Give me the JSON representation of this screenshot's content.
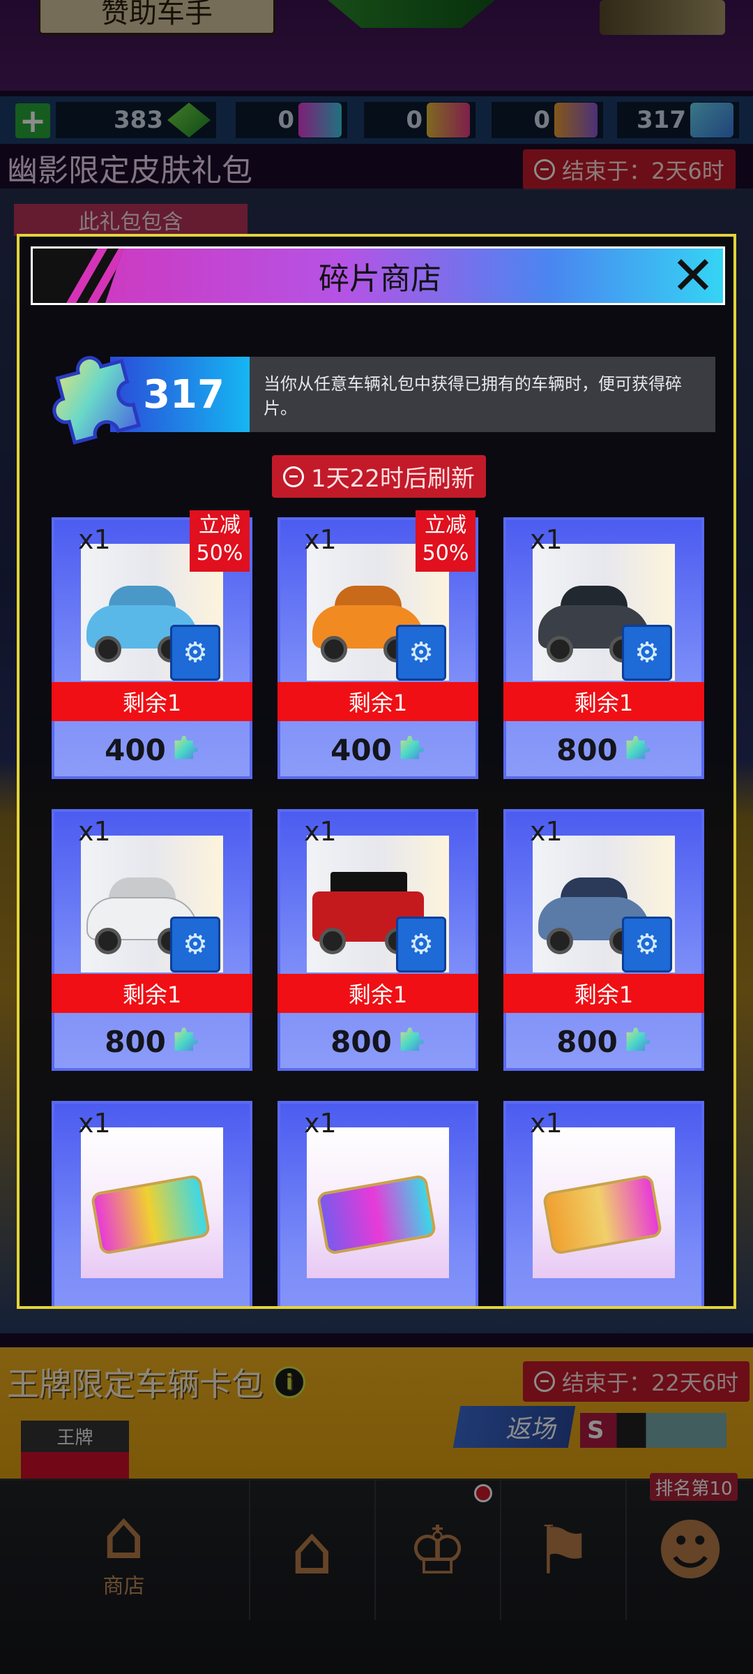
{
  "background": {
    "sponsor_label": "赞助车手",
    "resources": [
      {
        "value": "383",
        "icon": "green-gem-icon"
      },
      {
        "value": "0",
        "icon": "pink-skin-card-icon"
      },
      {
        "value": "0",
        "icon": "gold-skin-card-icon"
      },
      {
        "value": "0",
        "icon": "turbo-card-icon"
      },
      {
        "value": "317",
        "icon": "puzzle-icon"
      }
    ],
    "limited_pack_title": "幽影限定皮肤礼包",
    "limited_pack_timer": "结束于：2天6时",
    "pack_includes": "此礼包包含",
    "ace_pack_title": "王牌限定车辆卡包",
    "ace_pack_timer": "结束于：22天6时",
    "ace_tag": "王牌",
    "return_label": "返场",
    "s_badge": "S"
  },
  "modal": {
    "title": "碎片商店",
    "fragment_count": "317",
    "description": "当你从任意车辆礼包中获得已拥有的车辆时，便可获得碎片。",
    "refresh_text": "1天22时后刷新"
  },
  "items": [
    {
      "qty": "x1",
      "discount": "立减\n50%",
      "remain": "剩余1",
      "price": "400",
      "type": "car",
      "color": "#5ab8e8"
    },
    {
      "qty": "x1",
      "discount": "立减\n50%",
      "remain": "剩余1",
      "price": "400",
      "type": "car",
      "color": "#f28a22"
    },
    {
      "qty": "x1",
      "discount": "",
      "remain": "剩余1",
      "price": "800",
      "type": "car",
      "color": "#3a3f48"
    },
    {
      "qty": "x1",
      "discount": "",
      "remain": "剩余1",
      "price": "800",
      "type": "car",
      "color": "#eef0f2"
    },
    {
      "qty": "x1",
      "discount": "",
      "remain": "剩余1",
      "price": "800",
      "type": "car",
      "color": "#c41a1e"
    },
    {
      "qty": "x1",
      "discount": "",
      "remain": "剩余1",
      "price": "800",
      "type": "car",
      "color": "#5a7aa8"
    },
    {
      "qty": "x1",
      "type": "skin",
      "color": "#e83ad8"
    },
    {
      "qty": "x1",
      "type": "skin",
      "color": "#7a5aec"
    },
    {
      "qty": "x1",
      "type": "skin",
      "color": "#f0a030"
    }
  ],
  "nav": {
    "shop_label": "商店",
    "rank_label": "排名第10"
  }
}
